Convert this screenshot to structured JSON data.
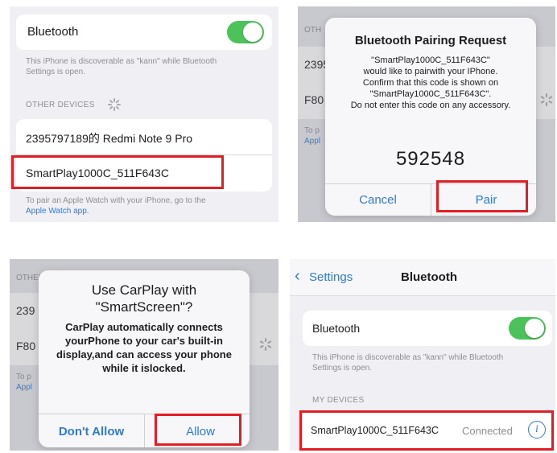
{
  "panel1": {
    "bluetooth_label": "Bluetooth",
    "toggle_on": true,
    "discoverable_text_1": "This iPhone is discoverable as \"kann\" while Bluetooth",
    "discoverable_text_2": "Settings is open.",
    "section_header": "OTHER DEVICES",
    "devices": [
      {
        "name": "2395797189的 Redmi Note 9 Pro"
      },
      {
        "name": "SmartPlay1000C_511F643C"
      }
    ],
    "footer_1": "To pair an Apple Watch with your iPhone, go to the",
    "footer_link": "Apple Watch app."
  },
  "panel2": {
    "bg_header": "OTH",
    "bg_row_1": "2395",
    "bg_row_2": "F80",
    "bg_footer_1": "To p",
    "bg_footer_2": "Appl",
    "dialog_title": "Bluetooth Pairing Request",
    "dialog_lines": [
      "\"SmartPlay1000C_511F643C\"",
      "would like to pairwith your IPhone.",
      "Confirm that this code is shown on",
      "\"SmartPlay1000C_511F643C\".",
      "Do not enter this code on any accessory."
    ],
    "pairing_code": "592548",
    "cancel_label": "Cancel",
    "pair_label": "Pair"
  },
  "panel3": {
    "bg_header": "OTHER DEVICES",
    "bg_row_1": "239",
    "bg_row_2": "F80",
    "bg_footer_1": "To p",
    "bg_footer_2": "Appl",
    "dialog_title_1": "Use CarPlay with",
    "dialog_title_2": "\"SmartScreen\"?",
    "dialog_body": [
      "CarPlay automatically connects",
      "yourPhone to your car's built-in",
      "display,and can access your phone",
      "while it islocked."
    ],
    "dont_allow_label": "Don't Allow",
    "allow_label": "Allow"
  },
  "panel4": {
    "back_label": "Settings",
    "nav_title": "Bluetooth",
    "bluetooth_label": "Bluetooth",
    "toggle_on": true,
    "discoverable_text_1": "This iPhone is discoverable as \"kann\" while Bluetooth",
    "discoverable_text_2": "Settings is open.",
    "section_header": "MY DEVICES",
    "device_name": "SmartPlay1000C_511F643C",
    "device_status": "Connected"
  },
  "colors": {
    "accent": "#2f7bd3",
    "toggle": "#4cc25a",
    "highlight": "#e01e24"
  }
}
